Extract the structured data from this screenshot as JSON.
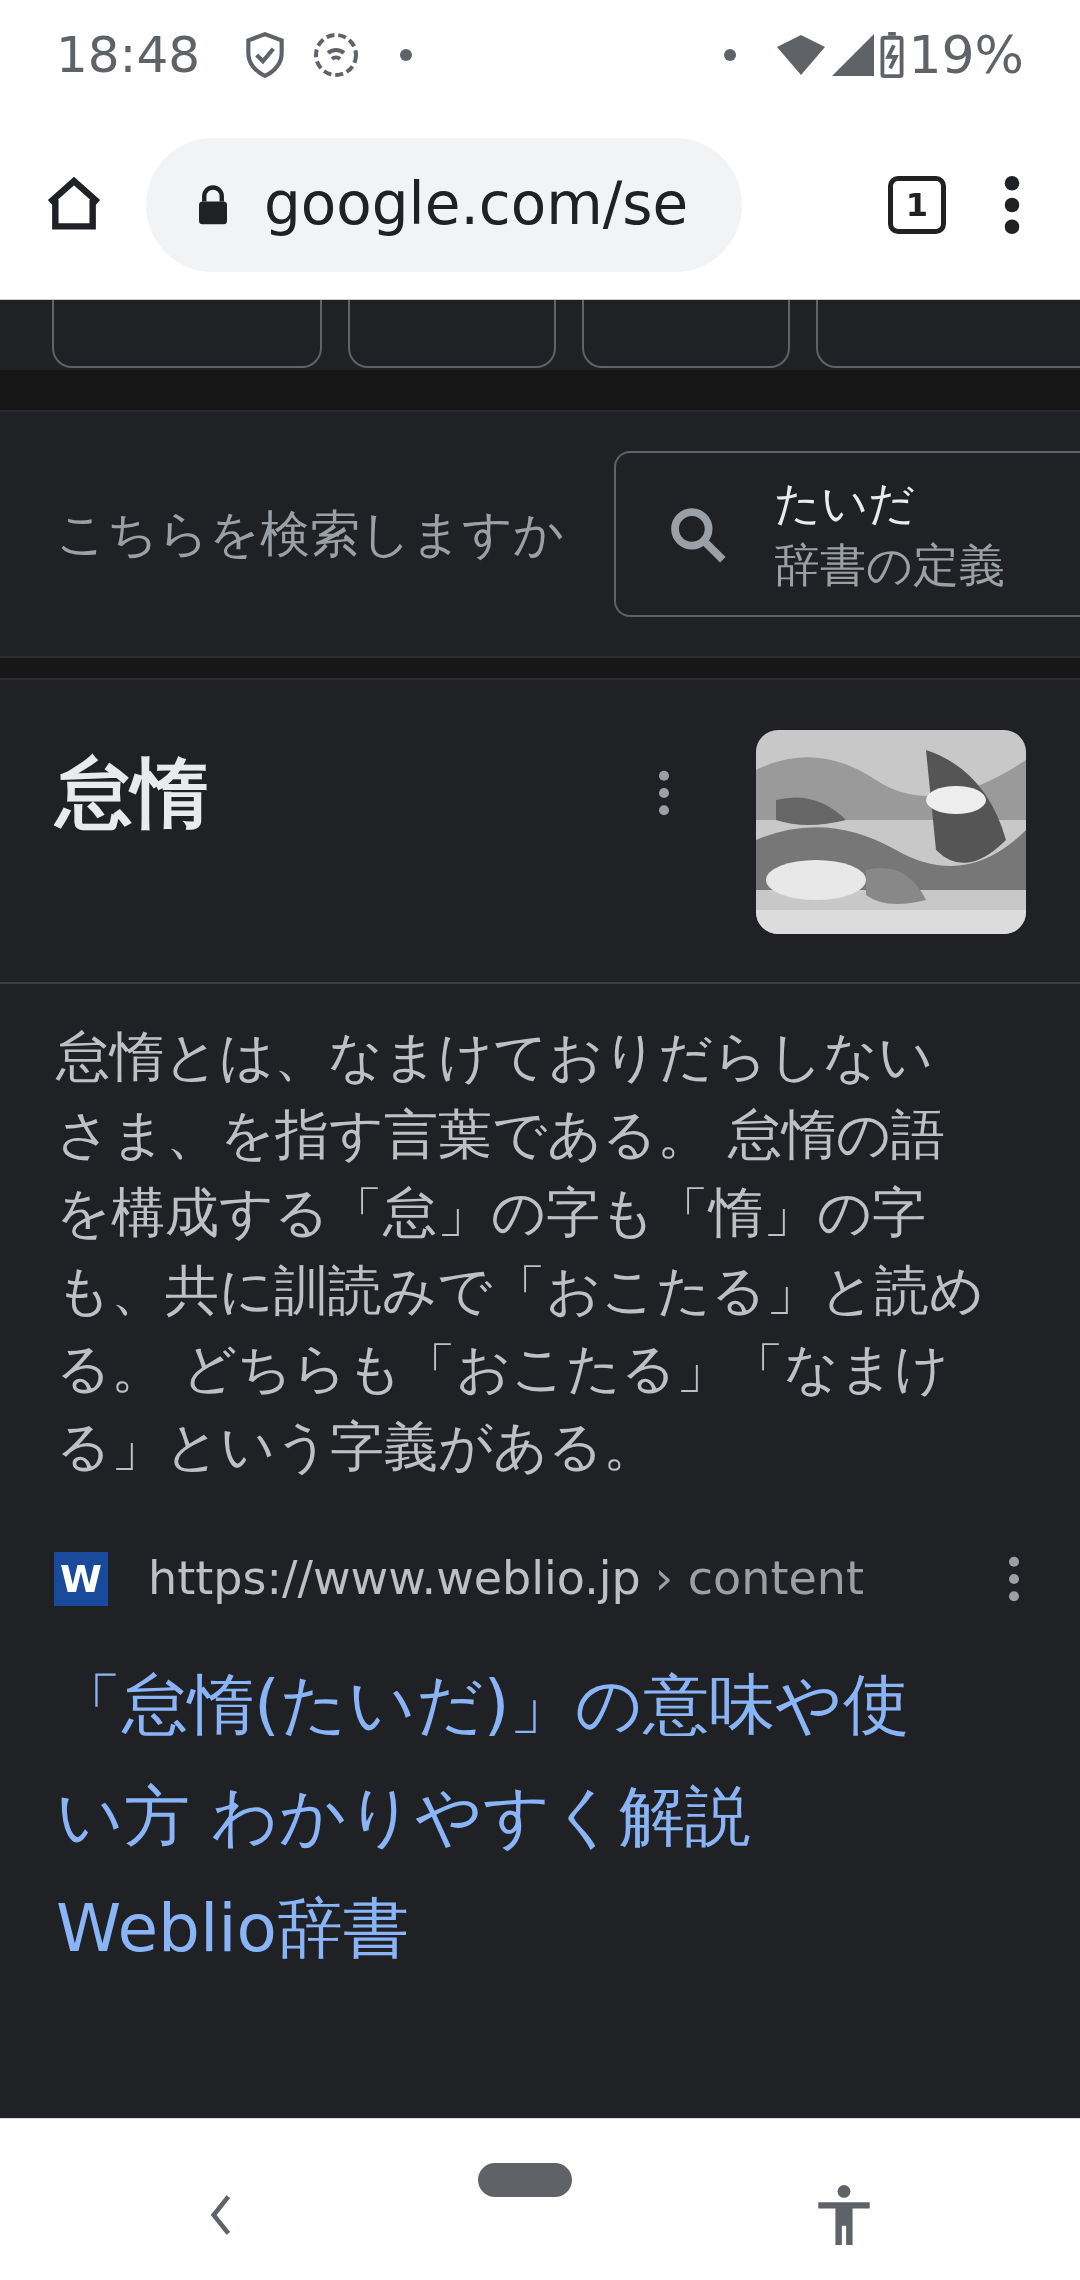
{
  "status_bar": {
    "time": "18:48",
    "battery": "19%"
  },
  "browser": {
    "url": "google.com/se",
    "tab_count": "1"
  },
  "chips": [
    {
      "kind": "chip"
    },
    {
      "kind": "chip"
    },
    {
      "kind": "chip"
    },
    {
      "kind": "chip"
    }
  ],
  "suggestion": {
    "prompt": "こちらを検索しますか",
    "query": "たいだ",
    "subtitle": "辞書の定義"
  },
  "result": {
    "title": "怠惰",
    "description": "怠惰とは、なまけておりだらしないさま、を指す言葉である。 怠惰の語を構成する「怠」の字も「惰」の字も、共に訓読みで「おこたる」と読める。 どちらも「おこたる」「なまける」という字義がある。",
    "source": {
      "favicon_letter": "W",
      "url": "https://www.weblio.jp",
      "path": "› content"
    },
    "link_title": "「怠惰(たいだ)」の意味や使い方 わかりやすく解説 Weblio辞書"
  }
}
